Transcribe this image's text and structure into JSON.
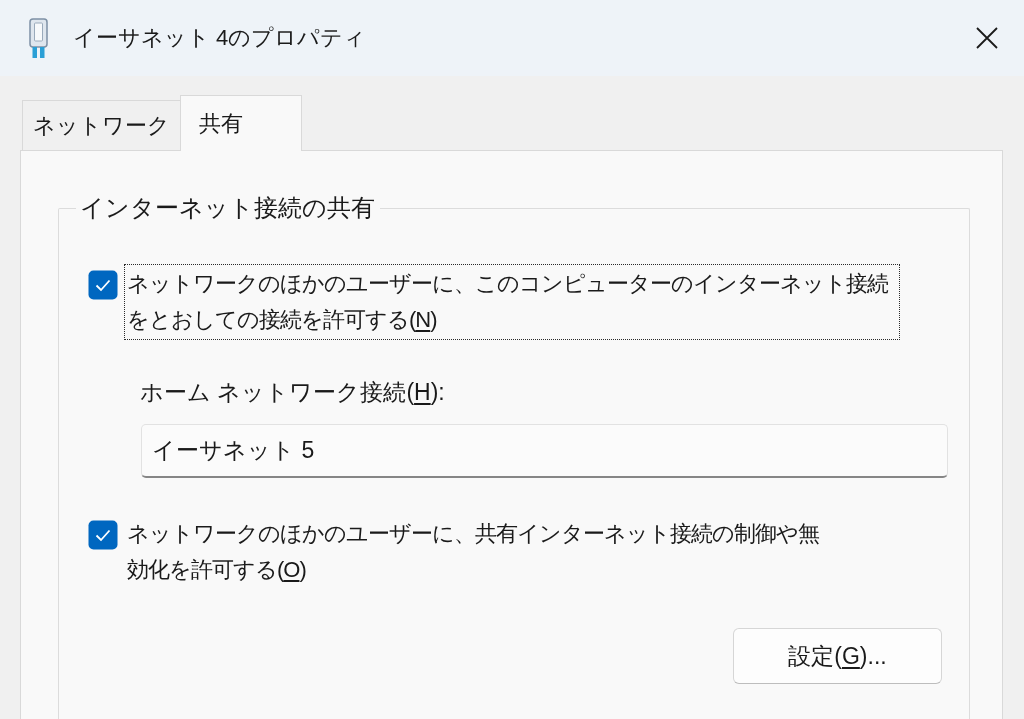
{
  "window": {
    "title": "イーサネット 4のプロパティ"
  },
  "tabs": [
    {
      "label": "ネットワーク",
      "selected": false
    },
    {
      "label": "共有",
      "selected": true
    }
  ],
  "sharing": {
    "title": "インターネット接続の共有",
    "items": [
      {
        "kind": "checkbox",
        "label": "ネットワークのほかのユーザーに、このコンピューターのインターネット接続をとおしての接続を許可する(N)",
        "checked": true,
        "focused": true
      },
      {
        "kind": "field",
        "label": "ホーム ネットワーク接続(H):",
        "value": "イーサネット 5"
      },
      {
        "kind": "checkbox",
        "label": "ネットワークのほかのユーザーに、共有インターネット接続の制御や無効化を許可する(O)",
        "checked": true,
        "focused": false
      },
      {
        "kind": "button",
        "label": "設定(G)..."
      }
    ]
  }
}
